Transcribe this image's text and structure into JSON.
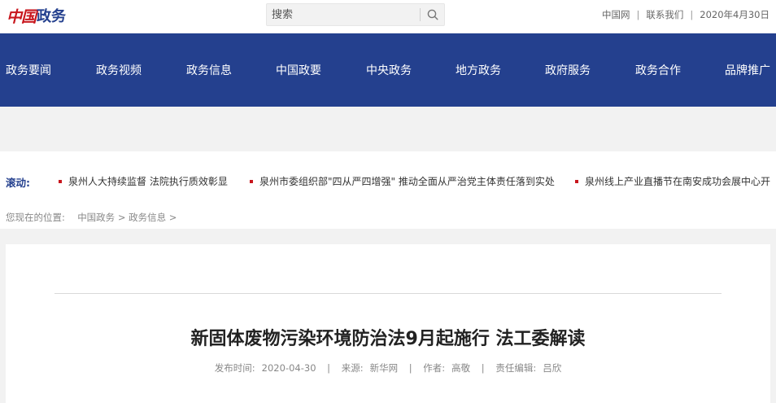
{
  "header": {
    "logo_china": "中国",
    "logo_gov": "政务",
    "search_placeholder": "搜索",
    "links": [
      "中国网",
      "联系我们"
    ],
    "date": "2020年4月30日"
  },
  "nav": {
    "items": [
      "政务要闻",
      "政务视频",
      "政务信息",
      "中国政要",
      "中央政务",
      "地方政务",
      "政府服务",
      "政务合作",
      "品牌推广"
    ]
  },
  "ticker": {
    "label": "滚动:",
    "items": [
      "泉州人大持续监督 法院执行质效彰显",
      "泉州市委组织部\"四从严四增强\" 推动全面从严治党主体责任落到实处",
      "泉州线上产业直播节在南安成功会展中心开"
    ]
  },
  "breadcrumb": {
    "prefix": "您现在的位置:",
    "crumbs": [
      "中国政务 >",
      "政务信息 >"
    ]
  },
  "article": {
    "title": "新固体废物污染环境防治法9月起施行 法工委解读",
    "published_label": "发布时间:",
    "published_value": "2020-04-30",
    "source_label": "来源:",
    "source_value": "新华网",
    "author_label": "作者:",
    "author_value": "高敬",
    "editor_label": "责任编辑:",
    "editor_value": "吕欣"
  },
  "colors": {
    "brand_blue": "#24408e",
    "brand_red": "#c8161d",
    "band_gray": "#f2f2f2"
  }
}
